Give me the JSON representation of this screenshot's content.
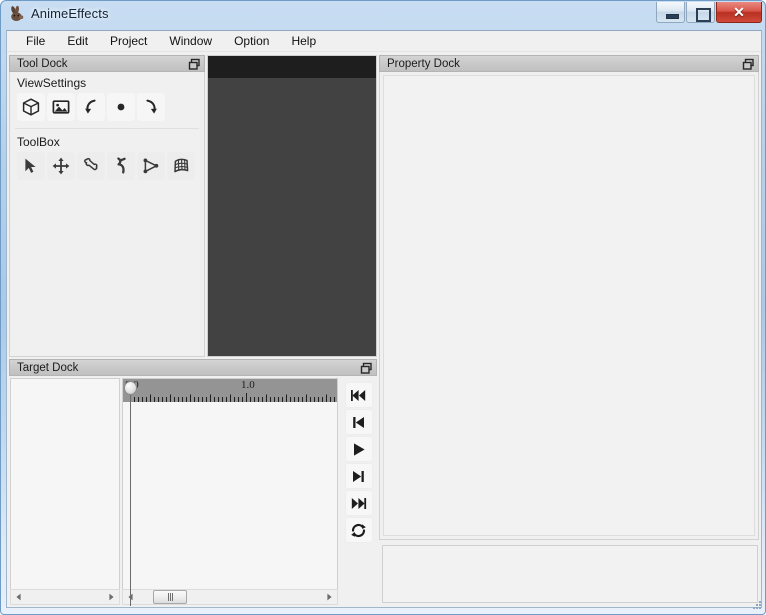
{
  "window": {
    "title": "AnimeEffects",
    "app_icon": "rabbit-icon",
    "buttons": {
      "minimize": "minimize-icon",
      "maximize": "maximize-icon",
      "close": "✕"
    }
  },
  "menubar": {
    "items": [
      {
        "label": "File"
      },
      {
        "label": "Edit"
      },
      {
        "label": "Project"
      },
      {
        "label": "Window"
      },
      {
        "label": "Option"
      },
      {
        "label": "Help"
      }
    ]
  },
  "tool_dock": {
    "title": "Tool Dock",
    "float_icon": "float-undock-icon",
    "sections": [
      {
        "label": "ViewSettings",
        "buttons": [
          {
            "name": "show-mesh-icon"
          },
          {
            "name": "show-image-icon"
          },
          {
            "name": "rotate-left-icon"
          },
          {
            "name": "center-dot-icon"
          },
          {
            "name": "rotate-right-icon"
          }
        ]
      },
      {
        "label": "ToolBox",
        "buttons": [
          {
            "name": "cursor-tool-icon"
          },
          {
            "name": "move-tool-icon"
          },
          {
            "name": "bone-tool-icon"
          },
          {
            "name": "pose-tool-icon"
          },
          {
            "name": "mesh-tool-icon"
          },
          {
            "name": "ffd-tool-icon"
          }
        ]
      }
    ]
  },
  "canvas": {
    "name": "main-canvas"
  },
  "target_dock": {
    "title": "Target Dock",
    "float_icon": "float-undock-icon",
    "timeline": {
      "ruler_labels": [
        {
          "text": "0.0",
          "pos": 2
        },
        {
          "text": "1.0",
          "pos": 118
        }
      ],
      "playhead_position": "0.0"
    },
    "playback_buttons": [
      {
        "name": "rewind-to-start-button",
        "icon": "skip-backward-icon"
      },
      {
        "name": "previous-frame-button",
        "icon": "step-backward-icon"
      },
      {
        "name": "play-button",
        "icon": "play-icon"
      },
      {
        "name": "next-frame-button",
        "icon": "step-forward-icon"
      },
      {
        "name": "forward-to-end-button",
        "icon": "skip-forward-icon"
      },
      {
        "name": "loop-button",
        "icon": "loop-icon"
      }
    ]
  },
  "property_dock": {
    "title": "Property Dock",
    "float_icon": "float-undock-icon"
  },
  "colors": {
    "title_bar": "#a9c9e8",
    "dock_header": "#c9c9c9",
    "canvas_bg": "#424242",
    "canvas_band": "#1e1e1e",
    "ruler": "#949494",
    "panel_bg": "#f0f0f0",
    "close_button": "#b93023"
  }
}
